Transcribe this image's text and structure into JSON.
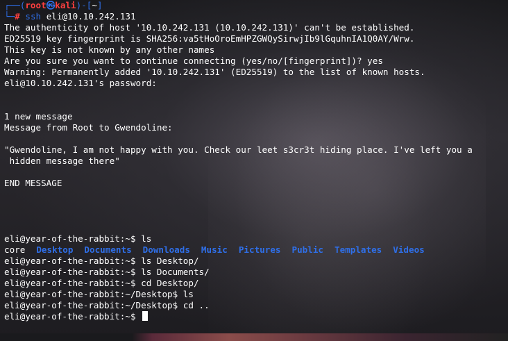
{
  "prompt_header": {
    "top_left": "┌──(",
    "user": "root",
    "skull": "㉿",
    "host": "kali",
    "mid": ")-[",
    "path": "~",
    "end": "]",
    "bottom_left": "└─",
    "hash": "#",
    "command": "ssh",
    "args": " eli@10.10.242.131"
  },
  "output_lines": [
    "The authenticity of host '10.10.242.131 (10.10.242.131)' can't be established.",
    "ED25519 key fingerprint is SHA256:va5tHoOroEmHPZGWQySirwjIb9lGquhnIA1Q0AY/Wrw.",
    "This key is not known by any other names",
    "Are you sure you want to continue connecting (yes/no/[fingerprint])? yes",
    "Warning: Permanently added '10.10.242.131' (ED25519) to the list of known hosts.",
    "eli@10.10.242.131's password:",
    "",
    "",
    "1 new message",
    "Message from Root to Gwendoline:",
    "",
    "\"Gwendoline, I am not happy with you. Check our leet s3cr3t hiding place. I've left you a",
    " hidden message there\"",
    "",
    "END MESSAGE",
    "",
    "",
    "",
    "",
    "eli@year-of-the-rabbit:~$ ls"
  ],
  "ls_output": {
    "plain": "core",
    "dirs": [
      "Desktop",
      "Documents",
      "Downloads",
      "Music",
      "Pictures",
      "Public",
      "Templates",
      "Videos"
    ]
  },
  "history_lines": [
    "eli@year-of-the-rabbit:~$ ls Desktop/",
    "eli@year-of-the-rabbit:~$ ls Documents/",
    "eli@year-of-the-rabbit:~$ cd Desktop/",
    "eli@year-of-the-rabbit:~/Desktop$ ls",
    "eli@year-of-the-rabbit:~/Desktop$ cd ..",
    "eli@year-of-the-rabbit:~$ "
  ],
  "colors": {
    "prompt_frame": "#2f6fe8",
    "user": "#ff4040",
    "directory": "#2f6fe8",
    "text": "#ffffff"
  }
}
